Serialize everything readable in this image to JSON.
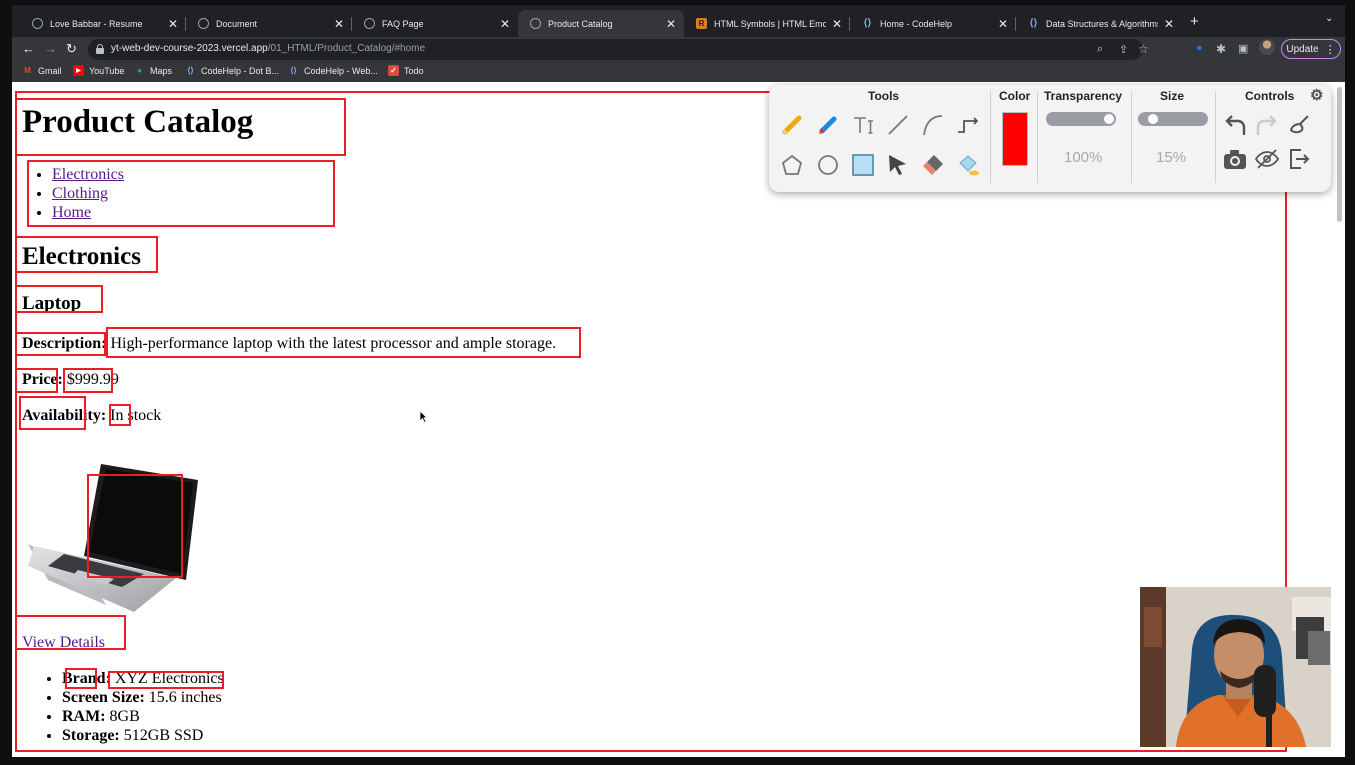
{
  "browser": {
    "tabs": [
      {
        "label": "Love Babbar - Resume",
        "favicon": "globe-icon",
        "active": false
      },
      {
        "label": "Document",
        "favicon": "globe-icon",
        "active": false
      },
      {
        "label": "FAQ Page",
        "favicon": "globe-icon",
        "active": false
      },
      {
        "label": "Product Catalog",
        "favicon": "globe-icon",
        "active": true
      },
      {
        "label": "HTML Symbols | HTML Emojis",
        "favicon": "r-icon",
        "active": false
      },
      {
        "label": "Home - CodeHelp",
        "favicon": "codehelp-icon",
        "active": false
      },
      {
        "label": "Data Structures & Algorithms i",
        "favicon": "codehelp-icon",
        "active": false
      }
    ],
    "tab_close": "✕",
    "new_tab": "+",
    "url_host": "yt-web-dev-course-2023.vercel.app",
    "url_path": "/01_HTML/Product_Catalog/#home",
    "update_label": "Update",
    "bookmarks": [
      {
        "label": "Gmail",
        "icon": "gmail-icon",
        "glyph": "M",
        "color": "#ea4335"
      },
      {
        "label": "YouTube",
        "icon": "youtube-icon",
        "glyph": "▶",
        "color": "#ff0000"
      },
      {
        "label": "Maps",
        "icon": "maps-pin-icon",
        "glyph": "●",
        "color": "#34a853"
      },
      {
        "label": "CodeHelp - Dot B...",
        "icon": "codehelp-icon",
        "glyph": "⟨⟩",
        "color": "#8ab4f8"
      },
      {
        "label": "CodeHelp - Web...",
        "icon": "codehelp-icon",
        "glyph": "⟨⟩",
        "color": "#8ab4f8"
      },
      {
        "label": "Todo",
        "icon": "todo-icon",
        "glyph": "✓",
        "color": "#db4c3f"
      }
    ]
  },
  "page": {
    "title": "Product Catalog",
    "nav": [
      "Electronics",
      "Clothing",
      "Home"
    ],
    "section": "Electronics",
    "product": {
      "name": "Laptop",
      "desc_label": "Description:",
      "desc_value": "High-performance laptop with the latest processor and ample storage.",
      "price_label": "Price:",
      "price_value": "$999.99",
      "avail_label": "Availability:",
      "avail_value": "In stock",
      "view_details": "View Details",
      "specs": [
        {
          "label": "Brand:",
          "value": "XYZ Electronics"
        },
        {
          "label": "Screen Size:",
          "value": "15.6 inches"
        },
        {
          "label": "RAM:",
          "value": "8GB"
        },
        {
          "label": "Storage:",
          "value": "512GB SSD"
        }
      ]
    }
  },
  "tools_panel": {
    "headings": {
      "tools": "Tools",
      "color": "Color",
      "transparency": "Transparency",
      "size": "Size",
      "controls": "Controls"
    },
    "selected_color": "#ff0000",
    "transparency_value": "100%",
    "transparency_level": 1.0,
    "size_value": "15%",
    "size_level": 0.15
  },
  "annotation_color": "#ee1c25"
}
